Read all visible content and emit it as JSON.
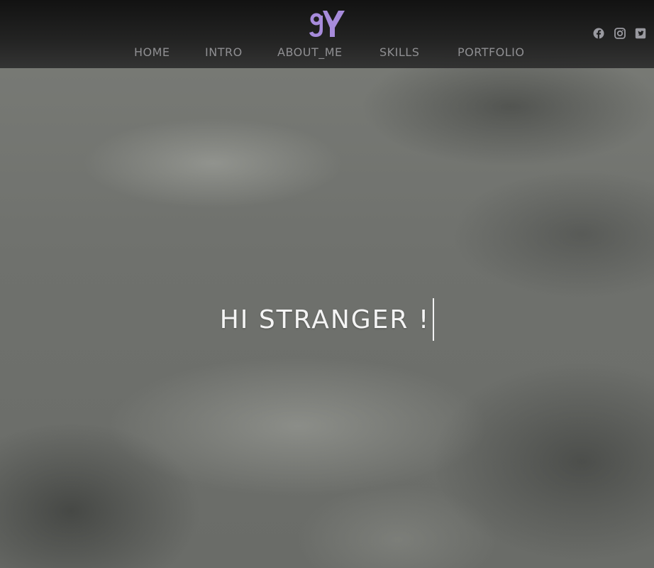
{
  "header": {
    "logo_text": "gY",
    "logo_color": "#a78bdb",
    "nav": [
      {
        "label": "HOME"
      },
      {
        "label": "INTRO"
      },
      {
        "label": "ABOUT_ME"
      },
      {
        "label": "SKILLS"
      },
      {
        "label": "PORTFOLIO"
      }
    ],
    "social": [
      {
        "icon": "facebook-icon"
      },
      {
        "icon": "instagram-icon"
      },
      {
        "icon": "twitter-icon"
      }
    ]
  },
  "hero": {
    "headline": "HI STRANGER !"
  }
}
